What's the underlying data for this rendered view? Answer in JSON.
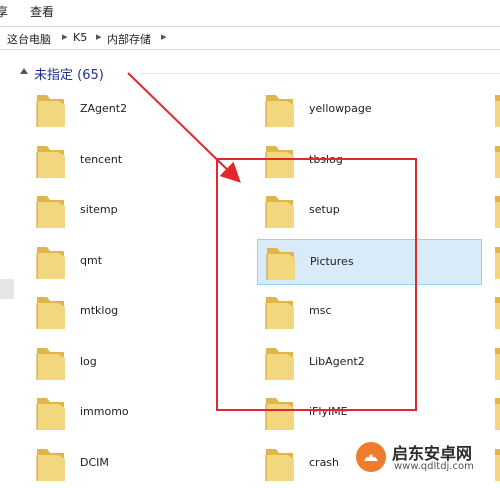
{
  "menu": {
    "item_0": "享",
    "item_1": "查看"
  },
  "breadcrumb": [
    "这台电脑",
    "K5",
    "内部存储"
  ],
  "group": {
    "label": "未指定 (65)"
  },
  "items_col1": [
    {
      "label": "ZAgent2"
    },
    {
      "label": "tencent"
    },
    {
      "label": "sitemp"
    },
    {
      "label": "qmt"
    },
    {
      "label": "mtklog"
    },
    {
      "label": "log"
    },
    {
      "label": "immomo"
    },
    {
      "label": "DCIM"
    }
  ],
  "items_col2": [
    {
      "label": "yellowpage",
      "selected": false
    },
    {
      "label": "tbslog",
      "selected": false
    },
    {
      "label": "setup",
      "selected": false
    },
    {
      "label": "Pictures",
      "selected": true
    },
    {
      "label": "msc",
      "selected": false
    },
    {
      "label": "LibAgent2",
      "selected": false
    },
    {
      "label": "iFlyIME",
      "selected": false
    },
    {
      "label": "crash",
      "selected": false
    }
  ],
  "watermark": {
    "title": "启东安卓网",
    "url": "www.qdltdj.com"
  },
  "colors": {
    "folder_front": "#f3d77e",
    "folder_back": "#e0b54c",
    "annotation": "#e0282d",
    "selection": "#d9ebf9"
  }
}
